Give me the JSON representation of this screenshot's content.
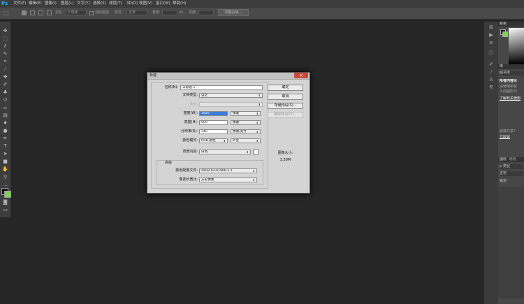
{
  "app": {
    "logo": "Ps"
  },
  "menu": [
    "文件(F)",
    "编辑(E)",
    "图像(I)",
    "图层(L)",
    "文字(Y)",
    "选择(S)",
    "滤镜(T)",
    "3D(D)",
    "视图(V)",
    "窗口(W)",
    "帮助(H)"
  ],
  "options": {
    "feather_label": "羽化:",
    "feather_value": "0 像素",
    "antialias_label": "消除锯齿",
    "style_label": "样式:",
    "style_value": "正常",
    "width_label": "宽度:",
    "height_label": "高度:",
    "refine_edge": "调整边缘..."
  },
  "dialog": {
    "title": "新建",
    "name_label": "名称(N):",
    "name_value": "未标题-1",
    "doc_type_label": "文档类型:",
    "doc_type_value": "自定",
    "size_label": "大小:",
    "width_label": "宽度(W):",
    "width_value": "1920",
    "width_unit": "像素",
    "height_label": "高度(H):",
    "height_value": "600",
    "height_unit": "像素",
    "resolution_label": "分辨率(R):",
    "resolution_value": "240",
    "resolution_unit": "像素/英寸",
    "color_mode_label": "颜色模式:",
    "color_mode_value": "RGB 颜色",
    "bit_depth": "8 位",
    "background_label": "背景内容:",
    "background_value": "白色",
    "advanced_label": "高级",
    "profile_label": "颜色配置文件:",
    "profile_value": "sRGB IEC61966-2.1",
    "pixel_aspect_label": "像素长宽比:",
    "pixel_aspect_value": "方形像素",
    "ok": "确定",
    "cancel": "取消",
    "save_preset": "存储预设(S)...",
    "delete_preset": "删除预设(D)...",
    "image_size_label": "图像大小:",
    "image_size_value": "3.30M"
  },
  "panels": {
    "color_tab": "颜色",
    "adjust_tab": "库",
    "libraries": "图书库",
    "all_content": "所有内容尽",
    "desc1": "请使用所有",
    "desc2": "入的图形元",
    "link": "了解有关使用",
    "share1": "需要共享?",
    "share_link": "立即试",
    "layers_tab": "图层",
    "channels_tab": "通道",
    "type_filter": "ρ 类型",
    "blend_normal": "正常",
    "lock_label": "锁定:"
  },
  "colors": {
    "accent": "#31a8ff",
    "fg_swatch": "#111111",
    "bg_swatch": "#7bd44a",
    "close": "#c9493c"
  }
}
